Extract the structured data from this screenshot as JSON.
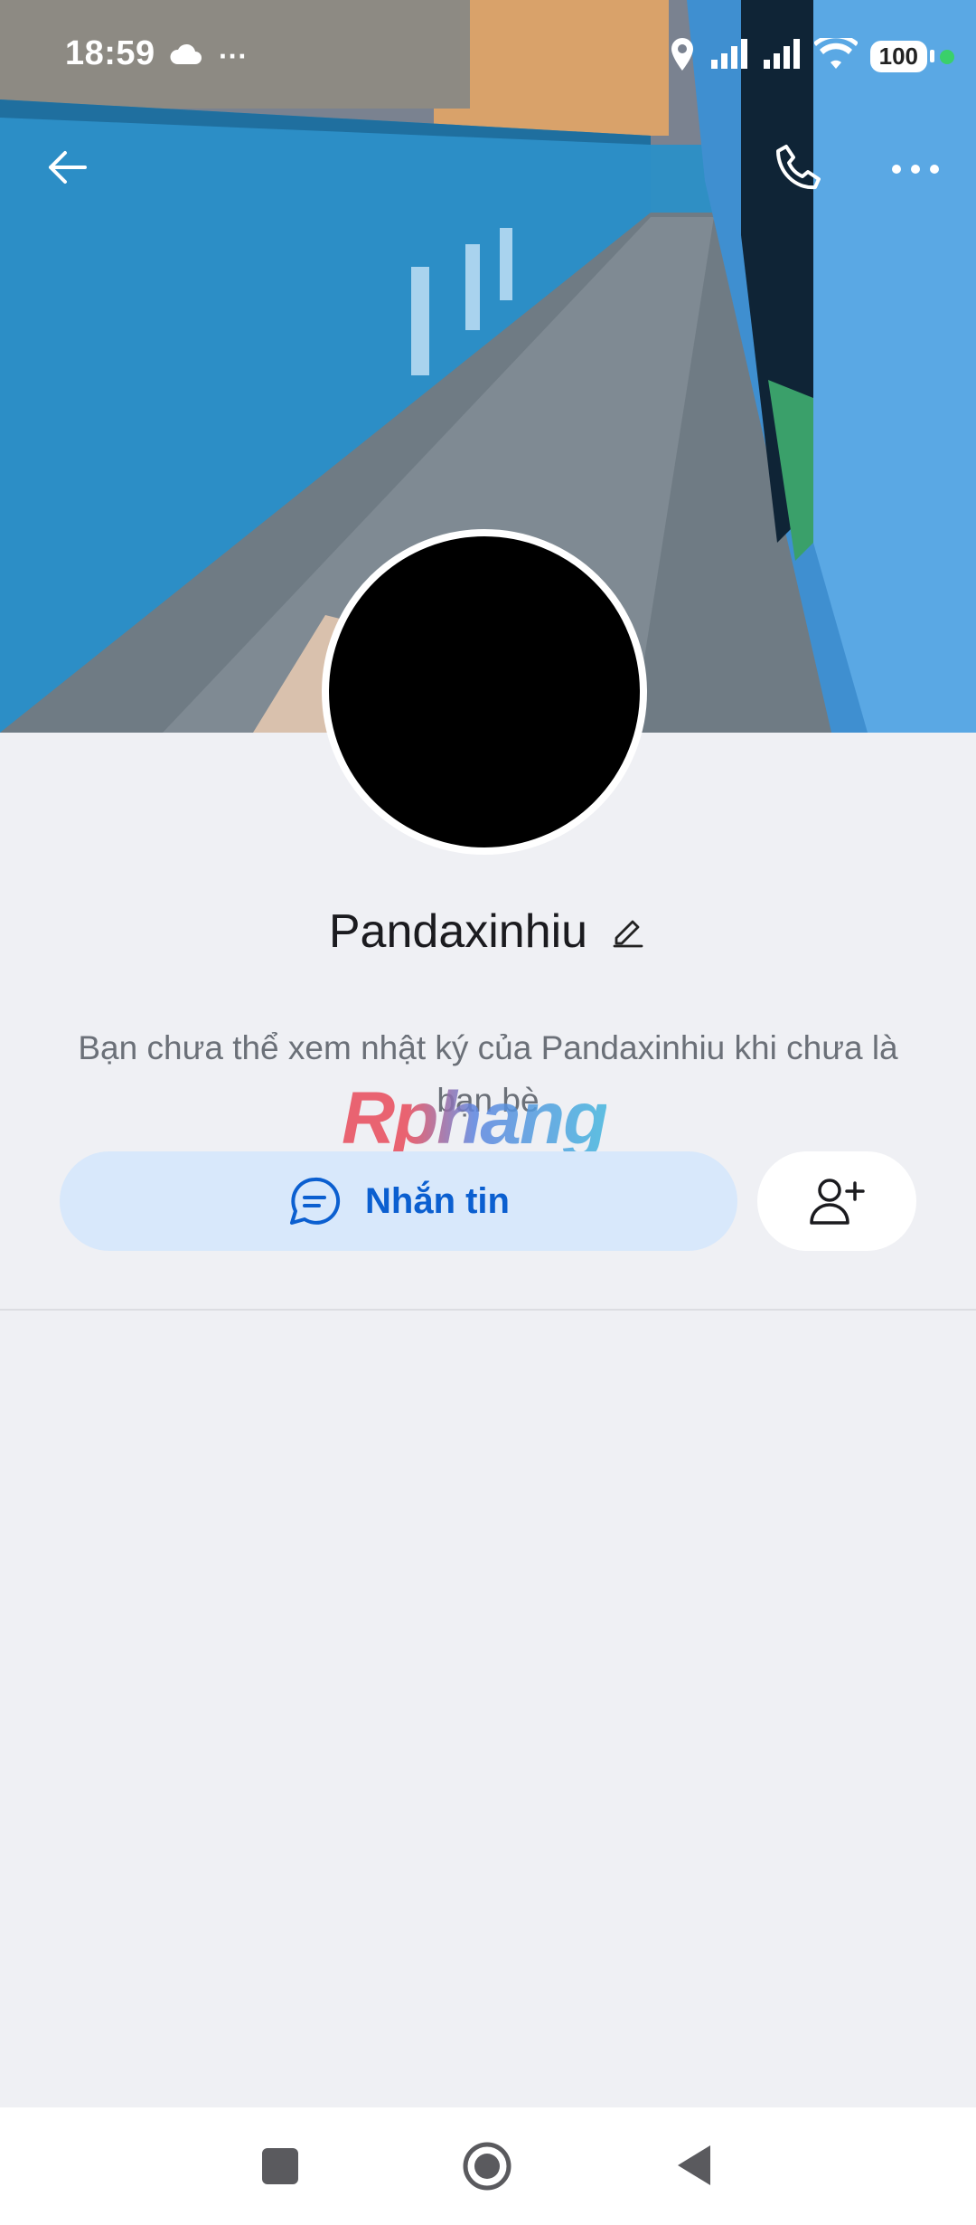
{
  "status_bar": {
    "time": "18:59",
    "ellipsis": "···",
    "battery": "100",
    "icons": [
      "cloud-icon",
      "location-icon",
      "signal-icon",
      "signal-icon",
      "wifi-icon",
      "battery-icon",
      "active-dot"
    ]
  },
  "header": {
    "icons": [
      "back-arrow-icon",
      "phone-icon",
      "more-dots-icon"
    ]
  },
  "profile": {
    "name": "Pandaxinhiu",
    "edit_icon": "pencil-icon",
    "info_text": "Bạn chưa thể xem nhật ký của Pandaxinhiu khi chưa là bạn bè"
  },
  "watermark": {
    "text": "Rphang"
  },
  "actions": {
    "message_label": "Nhắn tin",
    "message_icon": "chat-bubble-icon",
    "add_friend_icon": "add-user-icon"
  },
  "colors": {
    "accent": "#0b5fd0",
    "message_button_bg": "#d8e8fb",
    "page_bg": "#eff0f4"
  },
  "nav_bar": {
    "icons": [
      "recent-apps-icon",
      "home-icon",
      "back-icon"
    ]
  }
}
